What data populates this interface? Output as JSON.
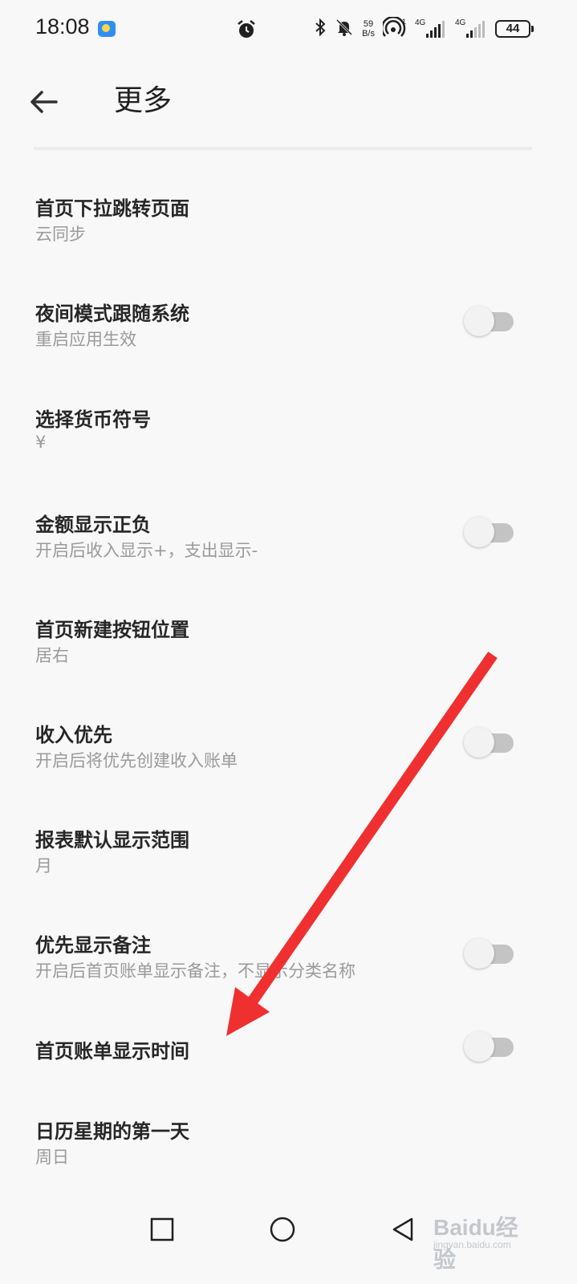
{
  "status_bar": {
    "time": "18:08",
    "net_speed_value": "59",
    "net_speed_unit": "B/s",
    "signal1_label": "4G",
    "signal2_label": "4G",
    "battery": "44",
    "icons": [
      "weather-icon",
      "alarm-icon",
      "bluetooth-icon",
      "bell-off-icon",
      "hotspot-icon",
      "signal-icon",
      "battery-icon"
    ]
  },
  "header": {
    "title": "更多",
    "back_icon": "arrow-left-icon"
  },
  "settings": [
    {
      "id": "pulldown-page",
      "title": "首页下拉跳转页面",
      "subtitle": "云同步",
      "has_toggle": false
    },
    {
      "id": "night-mode",
      "title": "夜间模式跟随系统",
      "subtitle": "重启应用生效",
      "has_toggle": true,
      "toggle_on": false
    },
    {
      "id": "currency-symbol",
      "title": "选择货币符号",
      "subtitle": "¥",
      "has_toggle": false
    },
    {
      "id": "amount-sign",
      "title": "金额显示正负",
      "subtitle": "开启后收入显示+，支出显示-",
      "has_toggle": true,
      "toggle_on": false
    },
    {
      "id": "new-button-position",
      "title": "首页新建按钮位置",
      "subtitle": "居右",
      "has_toggle": false
    },
    {
      "id": "income-first",
      "title": "收入优先",
      "subtitle": "开启后将优先创建收入账单",
      "has_toggle": true,
      "toggle_on": false
    },
    {
      "id": "report-range",
      "title": "报表默认显示范围",
      "subtitle": "月",
      "has_toggle": false
    },
    {
      "id": "note-first",
      "title": "优先显示备注",
      "subtitle": "开启后首页账单显示备注，不显示分类名称",
      "has_toggle": true,
      "toggle_on": false
    },
    {
      "id": "bill-time",
      "title": "首页账单显示时间",
      "subtitle": "",
      "has_toggle": true,
      "toggle_on": false
    },
    {
      "id": "week-start",
      "title": "日历星期的第一天",
      "subtitle": "周日",
      "has_toggle": false
    }
  ],
  "annotation": {
    "color": "#f03030"
  },
  "nav_bar": {
    "icons": [
      "recents-square-icon",
      "home-circle-icon",
      "back-triangle-icon"
    ]
  },
  "watermark": {
    "text": "Baidu经验",
    "sub": "jingyan.baidu.com"
  }
}
